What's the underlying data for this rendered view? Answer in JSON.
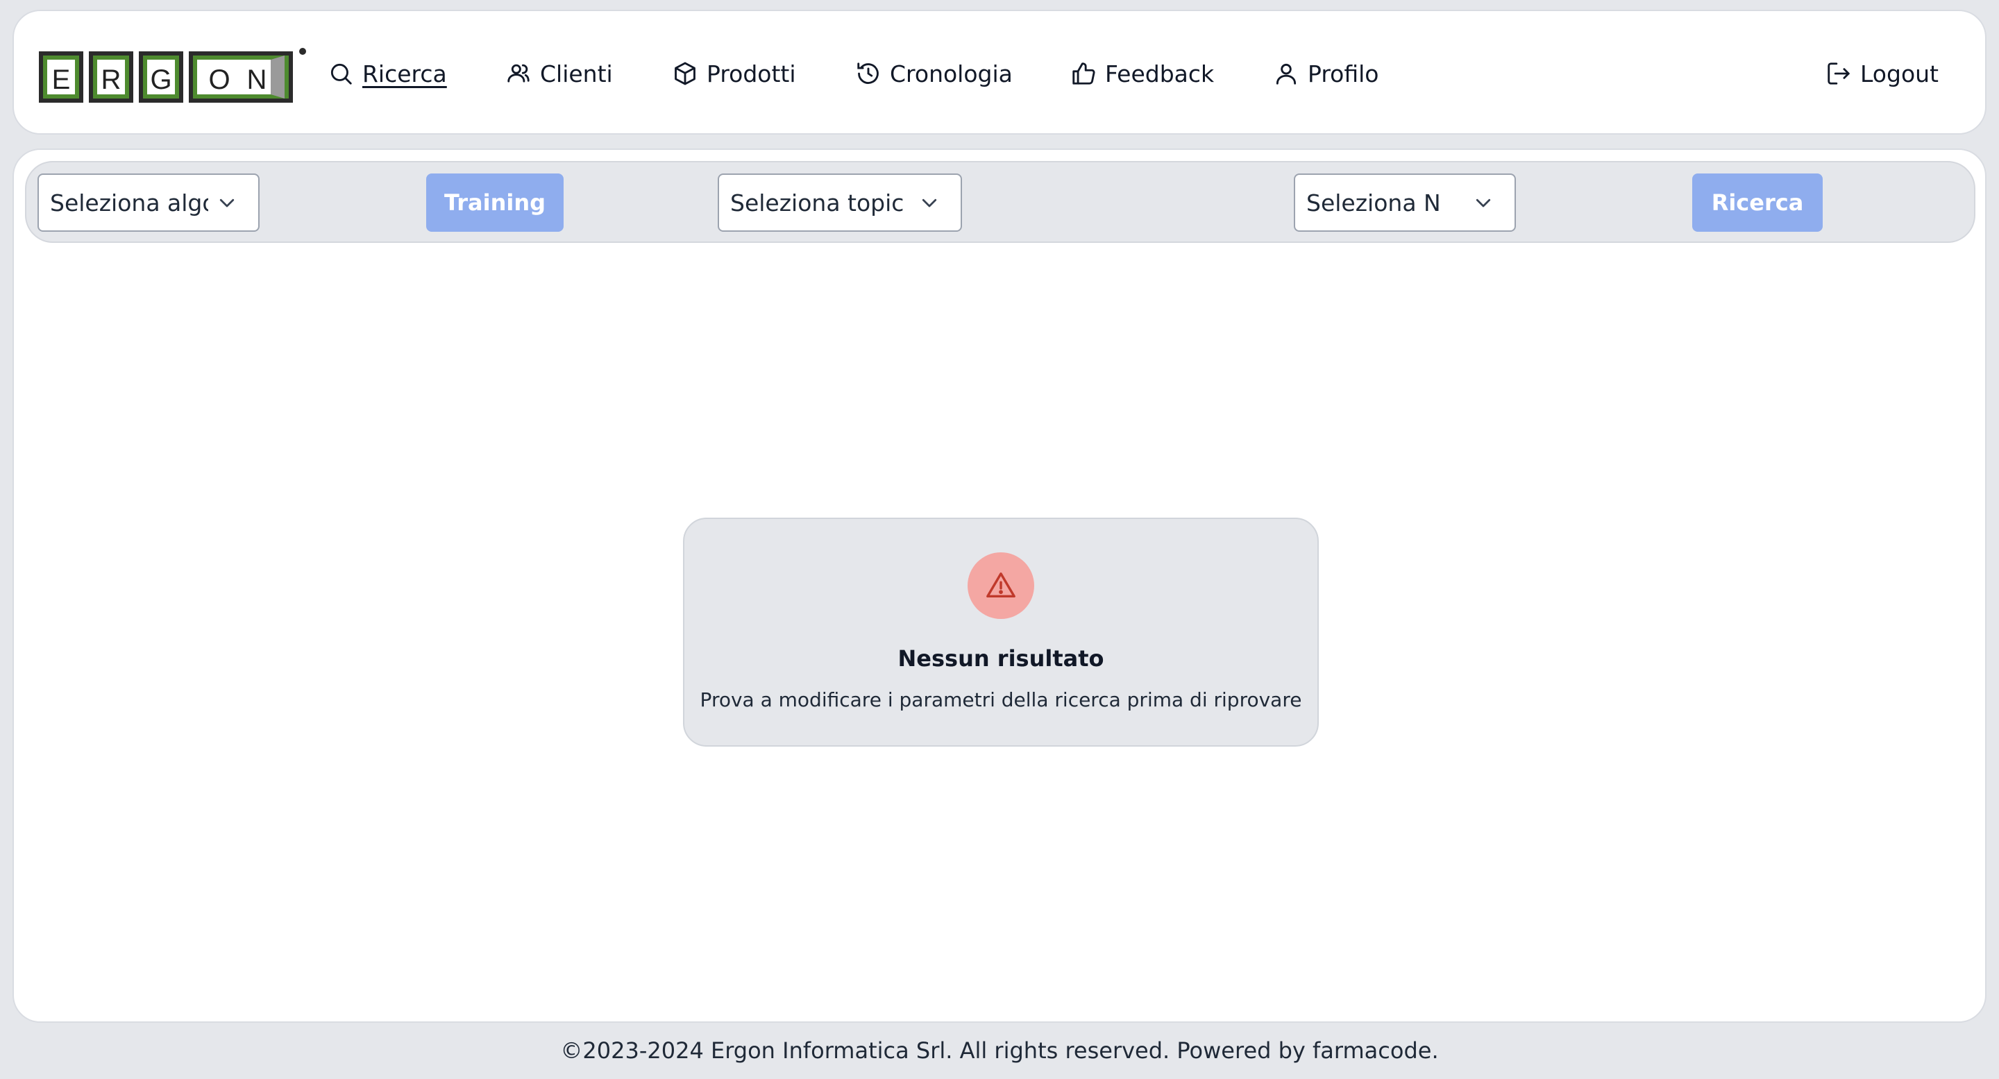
{
  "brand": {
    "logo_letters": [
      "E",
      "R",
      "G",
      "O",
      "N"
    ],
    "colors": {
      "logo_green": "#4e8b2f",
      "logo_dark": "#2b2b2b"
    }
  },
  "nav": {
    "items": [
      {
        "label": "Ricerca",
        "icon": "search-icon",
        "active": true
      },
      {
        "label": "Clienti",
        "icon": "users-icon"
      },
      {
        "label": "Prodotti",
        "icon": "cube-icon"
      },
      {
        "label": "Cronologia",
        "icon": "history-icon"
      },
      {
        "label": "Feedback",
        "icon": "thumbs-up-icon"
      },
      {
        "label": "Profilo",
        "icon": "user-icon"
      }
    ],
    "logout": {
      "label": "Logout",
      "icon": "logout-icon"
    }
  },
  "toolbar": {
    "algo_select": "Seleziona algo",
    "training_label": "Training",
    "topic_select": "Seleziona topic",
    "n_select": "Seleziona N",
    "search_label": "Ricerca",
    "colors": {
      "button_bg": "#8fadee"
    }
  },
  "empty_state": {
    "icon": "warning-icon",
    "title": "Nessun risultato",
    "subtitle": "Prova a modificare i parametri della ricerca prima di riprovare",
    "colors": {
      "icon_bg": "#f4a7a3",
      "icon_fg": "#c0392b"
    }
  },
  "footer": {
    "text": "©2023-2024 Ergon Informatica Srl. All rights reserved. Powered by farmacode."
  }
}
